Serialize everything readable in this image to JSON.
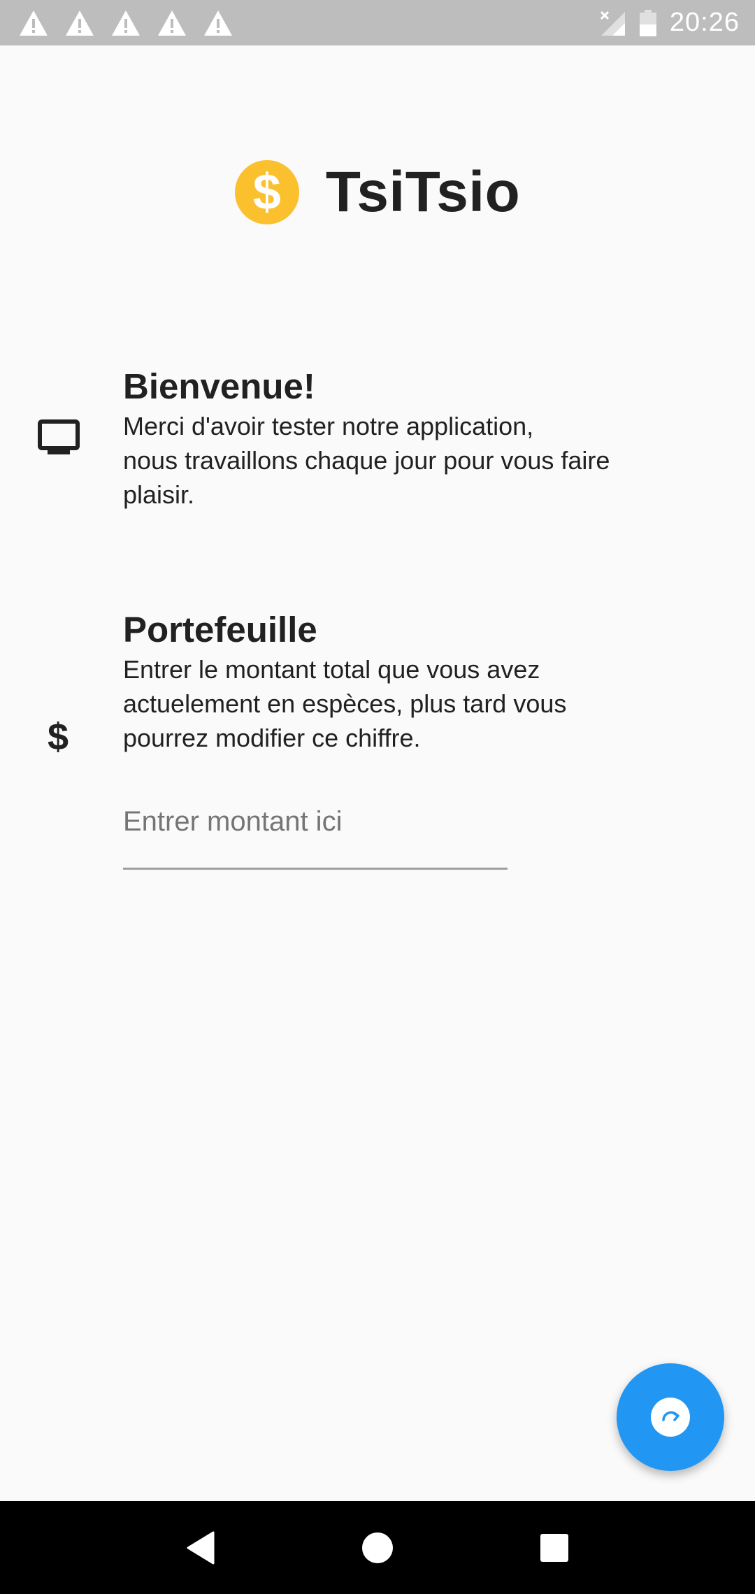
{
  "status_bar": {
    "time": "20:26",
    "notification_icons": [
      "warning-icon",
      "warning-icon",
      "warning-icon",
      "warning-icon",
      "warning-icon"
    ],
    "signal_icon": "no-signal-icon",
    "battery_icon": "battery-icon"
  },
  "header": {
    "logo_icon": "dollar-coin-icon",
    "logo_symbol": "$",
    "title": "TsiTsio",
    "logo_color": "#fbc02d"
  },
  "welcome": {
    "icon": "monitor-icon",
    "title": "Bienvenue!",
    "text": "Merci d'avoir tester notre application,\n nous travaillons chaque jour pour vous faire\n plaisir."
  },
  "wallet": {
    "icon": "dollar-icon",
    "icon_symbol": "$",
    "title": "Portefeuille",
    "text": "Entrer le montant total que vous avez\nactuelement en espèces, plus tard vous\npourrez modifier ce chiffre.",
    "amount_input": {
      "value": "",
      "placeholder": "Entrer montant ici"
    }
  },
  "fab": {
    "icon": "refresh-icon",
    "color": "#2196f3"
  },
  "nav_bar": {
    "back_icon": "back-triangle-icon",
    "home_icon": "home-circle-icon",
    "recents_icon": "recents-square-icon"
  }
}
